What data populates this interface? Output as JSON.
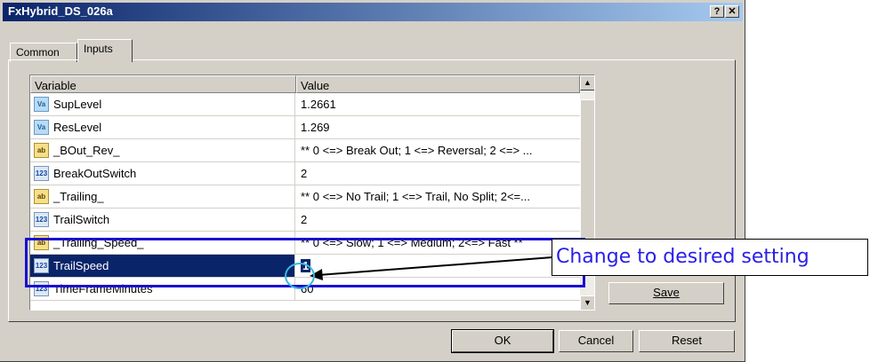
{
  "window": {
    "title": "FxHybrid_DS_026a",
    "help_label": "?",
    "close_label": "✕"
  },
  "tabs": [
    {
      "label": "Common"
    },
    {
      "label": "Inputs"
    }
  ],
  "grid": {
    "headers": {
      "variable": "Variable",
      "value": "Value"
    },
    "rows": [
      {
        "icon": "Va",
        "variable": "SupLevel",
        "value": "1.2661"
      },
      {
        "icon": "Va",
        "variable": "ResLevel",
        "value": "1.269"
      },
      {
        "icon": "ab",
        "variable": "_BOut_Rev_",
        "value": "** 0 <=> Break Out; 1 <=> Reversal; 2 <=> ..."
      },
      {
        "icon": "123",
        "variable": "BreakOutSwitch",
        "value": "2"
      },
      {
        "icon": "ab",
        "variable": "_Trailing_",
        "value": "** 0 <=> No Trail; 1 <=> Trail, No Split; 2<=..."
      },
      {
        "icon": "123",
        "variable": "TrailSwitch",
        "value": "2"
      },
      {
        "icon": "ab",
        "variable": "_Trailing_Speed_",
        "value": "** 0 <=> Slow; 1 <=> Medium; 2<=> Fast **"
      },
      {
        "icon": "123",
        "variable": "TrailSpeed",
        "value": "1"
      },
      {
        "icon": "123",
        "variable": "TimeFrameMinutes",
        "value": "60"
      }
    ]
  },
  "buttons": {
    "save": "Save",
    "ok": "OK",
    "cancel": "Cancel",
    "reset": "Reset"
  },
  "annotation": {
    "callout": "Change to desired setting",
    "color": "#1a0fd2"
  }
}
